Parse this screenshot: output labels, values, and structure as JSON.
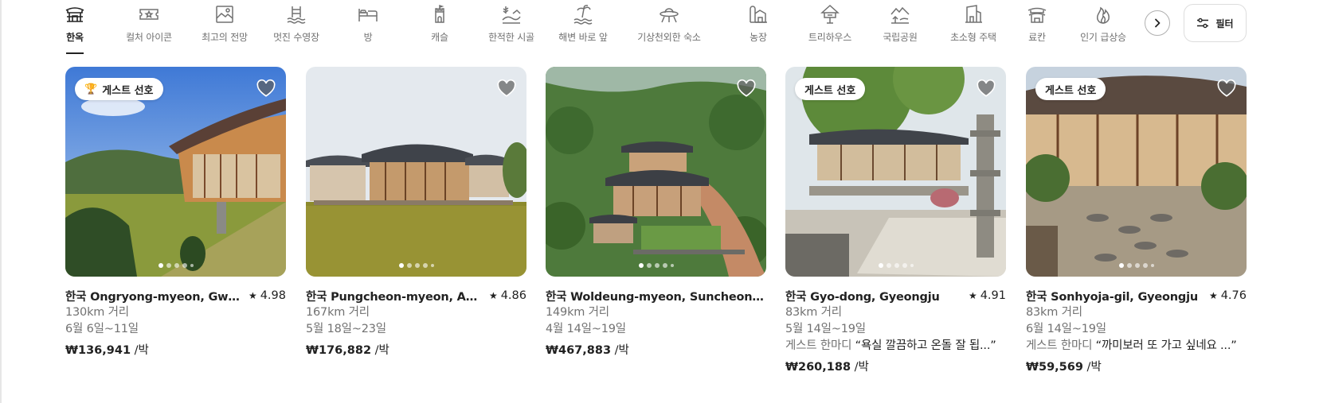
{
  "categories": [
    {
      "label": "한옥",
      "icon": "hanok-icon",
      "active": true
    },
    {
      "label": "컬처 아이콘",
      "icon": "culture-icon-ticket-icon",
      "active": false
    },
    {
      "label": "최고의 전망",
      "icon": "view-frame-icon",
      "active": false
    },
    {
      "label": "멋진 수영장",
      "icon": "pool-icon",
      "active": false
    },
    {
      "label": "방",
      "icon": "bed-icon",
      "active": false
    },
    {
      "label": "캐슬",
      "icon": "castle-icon",
      "active": false
    },
    {
      "label": "한적한 시골",
      "icon": "countryside-icon",
      "active": false
    },
    {
      "label": "해변 바로 앞",
      "icon": "beachfront-icon",
      "active": false
    },
    {
      "label": "기상천외한 숙소",
      "icon": "ufo-icon",
      "active": false
    },
    {
      "label": "농장",
      "icon": "farm-icon",
      "active": false
    },
    {
      "label": "트리하우스",
      "icon": "treehouse-icon",
      "active": false
    },
    {
      "label": "국립공원",
      "icon": "national-park-icon",
      "active": false
    },
    {
      "label": "초소형 주택",
      "icon": "tiny-home-icon",
      "active": false
    },
    {
      "label": "료칸",
      "icon": "ryokan-icon",
      "active": false
    },
    {
      "label": "인기 급상승",
      "icon": "flame-icon",
      "active": false
    }
  ],
  "toolbar": {
    "next_icon": "chevron-right-icon",
    "filter_label": "필터",
    "filter_icon": "sliders-icon"
  },
  "listings": [
    {
      "badge": "게스트 선호",
      "badge_icon": "trophy-icon",
      "title": "한국 Ongryong-myeon, Gwangyang-si",
      "rating": "4.98",
      "distance": "130km 거리",
      "dates": "6월 6일~11일",
      "review": "",
      "price": "₩136,941",
      "price_unit": " /박",
      "photo_count": 5,
      "current_photo": 1
    },
    {
      "badge": "",
      "badge_icon": "",
      "title": "한국 Pungcheon-myeon, Andong-si",
      "rating": "4.86",
      "distance": "167km 거리",
      "dates": "5월 18일~23일",
      "review": "",
      "price": "₩176,882",
      "price_unit": " /박",
      "photo_count": 5,
      "current_photo": 1
    },
    {
      "badge": "",
      "badge_icon": "",
      "title": "한국 Woldeung-myeon, Suncheon-si",
      "rating": "",
      "distance": "149km 거리",
      "dates": "4월 14일~19일",
      "review": "",
      "price": "₩467,883",
      "price_unit": " /박",
      "photo_count": 5,
      "current_photo": 1
    },
    {
      "badge": "게스트 선호",
      "badge_icon": "",
      "title": "한국 Gyo-dong, Gyeongju",
      "rating": "4.91",
      "distance": "83km 거리",
      "dates": "5월 14일~19일",
      "review_prefix": "게스트 한마디 ",
      "review": "“욕실 깔끔하고 온돌 잘 됩...”",
      "price": "₩260,188",
      "price_unit": " /박",
      "photo_count": 5,
      "current_photo": 1
    },
    {
      "badge": "게스트 선호",
      "badge_icon": "",
      "title": "한국 Sonhyoja-gil, Gyeongju",
      "rating": "4.76",
      "distance": "83km 거리",
      "dates": "6월 14일~19일",
      "review_prefix": "게스트 한마디 ",
      "review": "“까미보러 또 가고 싶네요 ...”",
      "price": "₩59,569",
      "price_unit": " /박",
      "photo_count": 5,
      "current_photo": 1
    }
  ],
  "colors": {
    "text": "#222222",
    "muted": "#717171",
    "heart_fill": "#5c5c5c",
    "border": "#dddddd"
  }
}
